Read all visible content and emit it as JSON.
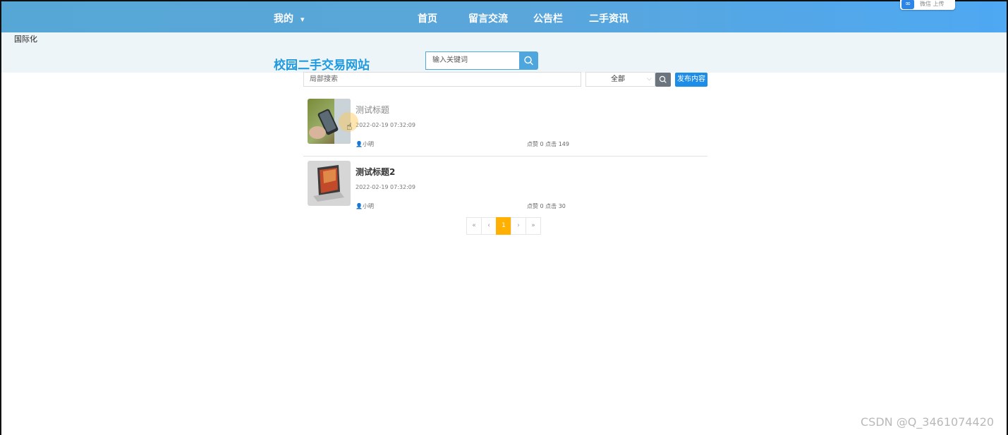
{
  "topnav": {
    "my_label": "我的",
    "my_caret": "▾",
    "items": [
      "首页",
      "留言交流",
      "公告栏",
      "二手资讯"
    ],
    "tray_badge_text": "微信 上传"
  },
  "corner_text": "国际化",
  "header": {
    "site_title": "校园二手交易网站",
    "search_placeholder": "输入关键词"
  },
  "filters": {
    "local_search_placeholder": "局部搜索",
    "category_selected": "全部",
    "publish_label": "发布内容"
  },
  "items": [
    {
      "title": "测试标题",
      "date": "2022-02-19 07:32:09",
      "author": "小明",
      "stats": "点赞 0 点击 149"
    },
    {
      "title": "测试标题2",
      "date": "2022-02-19 07:32:09",
      "author": "小明",
      "stats": "点赞 0 点击 30"
    }
  ],
  "pagination": {
    "first": "«",
    "prev": "‹",
    "current": "1",
    "next": "›",
    "last": "»"
  },
  "watermark": "CSDN @Q_3461074420",
  "colors": {
    "topbar": "#56a7d6",
    "brand": "#1e9ae0",
    "publish": "#1e8de8",
    "page_active": "#ffb000"
  }
}
